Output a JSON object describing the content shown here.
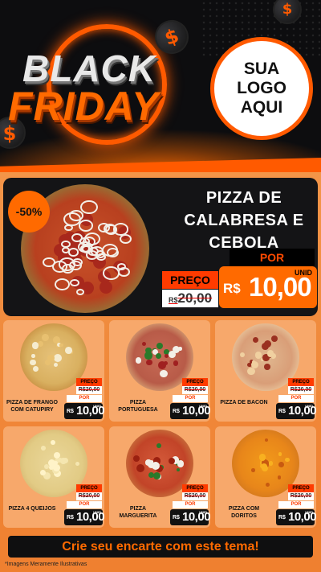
{
  "header": {
    "title_line1": "BLACK",
    "title_line2": "FRIDAY",
    "coin_symbol": "$",
    "logo_text": "SUA LOGO AQUI"
  },
  "hero": {
    "discount_badge": "-50%",
    "product_name": "PIZZA DE CALABRESA E CEBOLA",
    "por_label": "POR",
    "preco_label": "PREÇO",
    "old_price_currency": "R$",
    "old_price": "20,00",
    "currency": "R$",
    "price": "10,00",
    "unit": "UNID"
  },
  "products": [
    {
      "name": "PIZZA DE FRANGO COM CATUPIRY",
      "preco_label": "PREÇO",
      "old_price": "R$20,00",
      "por_label": "POR",
      "currency": "R$",
      "price": "10,00",
      "unit": "UNID"
    },
    {
      "name": "PIZZA PORTUGUESA",
      "preco_label": "PREÇO",
      "old_price": "R$20,00",
      "por_label": "POR",
      "currency": "R$",
      "price": "10,00",
      "unit": "UNID"
    },
    {
      "name": "PIZZA DE BACON",
      "preco_label": "PREÇO",
      "old_price": "R$20,00",
      "por_label": "POR",
      "currency": "R$",
      "price": "10,00",
      "unit": "UNID"
    },
    {
      "name": "PIZZA 4 QUEIJOS",
      "preco_label": "PREÇO",
      "old_price": "R$20,00",
      "por_label": "POR",
      "currency": "R$",
      "price": "10,00",
      "unit": "UNID"
    },
    {
      "name": "PIZZA MARGUERITA",
      "preco_label": "PREÇO",
      "old_price": "R$20,00",
      "por_label": "POR",
      "currency": "R$",
      "price": "10,00",
      "unit": "UNID"
    },
    {
      "name": "PIZZA COM DORITOS",
      "preco_label": "PREÇO",
      "old_price": "R$20,00",
      "por_label": "POR",
      "currency": "R$",
      "price": "10,00",
      "unit": "UNID"
    }
  ],
  "footer": {
    "cta": "Crie seu encarte com este tema!",
    "disclaimer": "*Imagens Meramente Ilustrativas"
  },
  "colors": {
    "accent": "#ff6a00",
    "header_bg": "#0d0d0f",
    "card_bg": "#f7a86b"
  }
}
